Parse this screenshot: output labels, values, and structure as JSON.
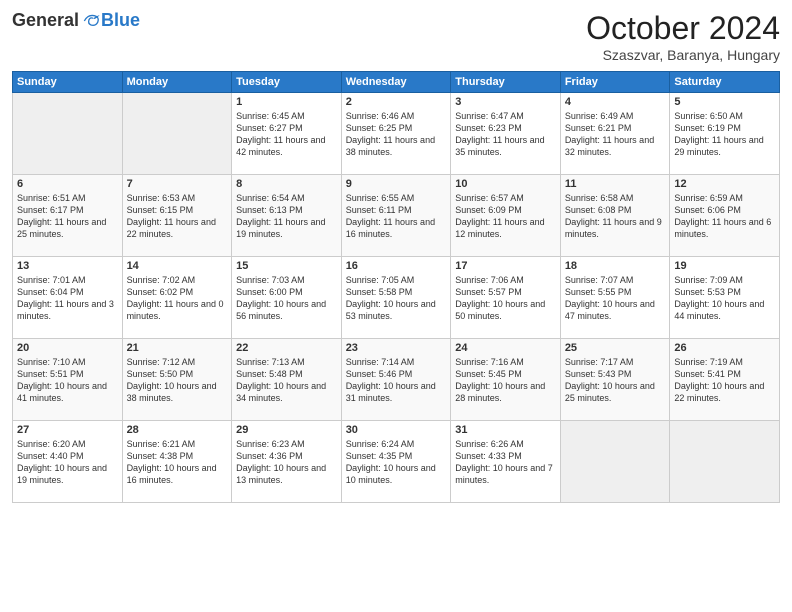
{
  "header": {
    "logo_general": "General",
    "logo_blue": "Blue",
    "month_title": "October 2024",
    "location": "Szaszvar, Baranya, Hungary"
  },
  "days_of_week": [
    "Sunday",
    "Monday",
    "Tuesday",
    "Wednesday",
    "Thursday",
    "Friday",
    "Saturday"
  ],
  "weeks": [
    [
      {
        "num": "",
        "info": "",
        "empty": true
      },
      {
        "num": "",
        "info": "",
        "empty": true
      },
      {
        "num": "1",
        "info": "Sunrise: 6:45 AM\nSunset: 6:27 PM\nDaylight: 11 hours and 42 minutes.",
        "empty": false
      },
      {
        "num": "2",
        "info": "Sunrise: 6:46 AM\nSunset: 6:25 PM\nDaylight: 11 hours and 38 minutes.",
        "empty": false
      },
      {
        "num": "3",
        "info": "Sunrise: 6:47 AM\nSunset: 6:23 PM\nDaylight: 11 hours and 35 minutes.",
        "empty": false
      },
      {
        "num": "4",
        "info": "Sunrise: 6:49 AM\nSunset: 6:21 PM\nDaylight: 11 hours and 32 minutes.",
        "empty": false
      },
      {
        "num": "5",
        "info": "Sunrise: 6:50 AM\nSunset: 6:19 PM\nDaylight: 11 hours and 29 minutes.",
        "empty": false
      }
    ],
    [
      {
        "num": "6",
        "info": "Sunrise: 6:51 AM\nSunset: 6:17 PM\nDaylight: 11 hours and 25 minutes.",
        "empty": false
      },
      {
        "num": "7",
        "info": "Sunrise: 6:53 AM\nSunset: 6:15 PM\nDaylight: 11 hours and 22 minutes.",
        "empty": false
      },
      {
        "num": "8",
        "info": "Sunrise: 6:54 AM\nSunset: 6:13 PM\nDaylight: 11 hours and 19 minutes.",
        "empty": false
      },
      {
        "num": "9",
        "info": "Sunrise: 6:55 AM\nSunset: 6:11 PM\nDaylight: 11 hours and 16 minutes.",
        "empty": false
      },
      {
        "num": "10",
        "info": "Sunrise: 6:57 AM\nSunset: 6:09 PM\nDaylight: 11 hours and 12 minutes.",
        "empty": false
      },
      {
        "num": "11",
        "info": "Sunrise: 6:58 AM\nSunset: 6:08 PM\nDaylight: 11 hours and 9 minutes.",
        "empty": false
      },
      {
        "num": "12",
        "info": "Sunrise: 6:59 AM\nSunset: 6:06 PM\nDaylight: 11 hours and 6 minutes.",
        "empty": false
      }
    ],
    [
      {
        "num": "13",
        "info": "Sunrise: 7:01 AM\nSunset: 6:04 PM\nDaylight: 11 hours and 3 minutes.",
        "empty": false
      },
      {
        "num": "14",
        "info": "Sunrise: 7:02 AM\nSunset: 6:02 PM\nDaylight: 11 hours and 0 minutes.",
        "empty": false
      },
      {
        "num": "15",
        "info": "Sunrise: 7:03 AM\nSunset: 6:00 PM\nDaylight: 10 hours and 56 minutes.",
        "empty": false
      },
      {
        "num": "16",
        "info": "Sunrise: 7:05 AM\nSunset: 5:58 PM\nDaylight: 10 hours and 53 minutes.",
        "empty": false
      },
      {
        "num": "17",
        "info": "Sunrise: 7:06 AM\nSunset: 5:57 PM\nDaylight: 10 hours and 50 minutes.",
        "empty": false
      },
      {
        "num": "18",
        "info": "Sunrise: 7:07 AM\nSunset: 5:55 PM\nDaylight: 10 hours and 47 minutes.",
        "empty": false
      },
      {
        "num": "19",
        "info": "Sunrise: 7:09 AM\nSunset: 5:53 PM\nDaylight: 10 hours and 44 minutes.",
        "empty": false
      }
    ],
    [
      {
        "num": "20",
        "info": "Sunrise: 7:10 AM\nSunset: 5:51 PM\nDaylight: 10 hours and 41 minutes.",
        "empty": false
      },
      {
        "num": "21",
        "info": "Sunrise: 7:12 AM\nSunset: 5:50 PM\nDaylight: 10 hours and 38 minutes.",
        "empty": false
      },
      {
        "num": "22",
        "info": "Sunrise: 7:13 AM\nSunset: 5:48 PM\nDaylight: 10 hours and 34 minutes.",
        "empty": false
      },
      {
        "num": "23",
        "info": "Sunrise: 7:14 AM\nSunset: 5:46 PM\nDaylight: 10 hours and 31 minutes.",
        "empty": false
      },
      {
        "num": "24",
        "info": "Sunrise: 7:16 AM\nSunset: 5:45 PM\nDaylight: 10 hours and 28 minutes.",
        "empty": false
      },
      {
        "num": "25",
        "info": "Sunrise: 7:17 AM\nSunset: 5:43 PM\nDaylight: 10 hours and 25 minutes.",
        "empty": false
      },
      {
        "num": "26",
        "info": "Sunrise: 7:19 AM\nSunset: 5:41 PM\nDaylight: 10 hours and 22 minutes.",
        "empty": false
      }
    ],
    [
      {
        "num": "27",
        "info": "Sunrise: 6:20 AM\nSunset: 4:40 PM\nDaylight: 10 hours and 19 minutes.",
        "empty": false
      },
      {
        "num": "28",
        "info": "Sunrise: 6:21 AM\nSunset: 4:38 PM\nDaylight: 10 hours and 16 minutes.",
        "empty": false
      },
      {
        "num": "29",
        "info": "Sunrise: 6:23 AM\nSunset: 4:36 PM\nDaylight: 10 hours and 13 minutes.",
        "empty": false
      },
      {
        "num": "30",
        "info": "Sunrise: 6:24 AM\nSunset: 4:35 PM\nDaylight: 10 hours and 10 minutes.",
        "empty": false
      },
      {
        "num": "31",
        "info": "Sunrise: 6:26 AM\nSunset: 4:33 PM\nDaylight: 10 hours and 7 minutes.",
        "empty": false
      },
      {
        "num": "",
        "info": "",
        "empty": true
      },
      {
        "num": "",
        "info": "",
        "empty": true
      }
    ]
  ]
}
